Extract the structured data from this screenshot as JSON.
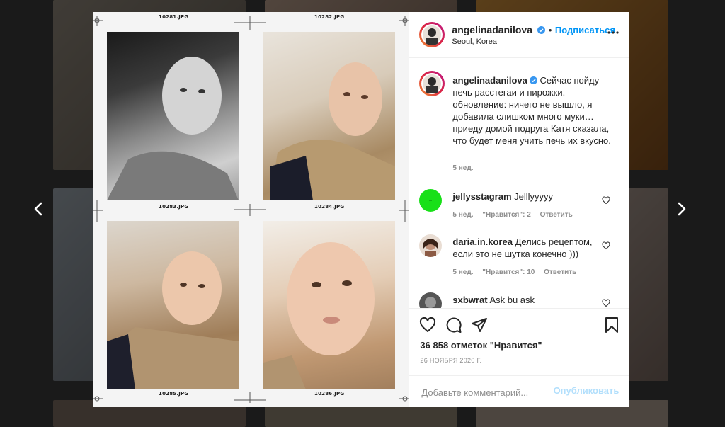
{
  "colors": {
    "accent": "#0095f6",
    "publish_disabled": "#b2dffc",
    "text": "#262626",
    "muted": "#8e8e8e"
  },
  "nav": {
    "prev_icon": "chevron-left-icon",
    "next_icon": "chevron-right-icon"
  },
  "media": {
    "frames": [
      {
        "label": "10281.JPG"
      },
      {
        "label": "10282.JPG"
      },
      {
        "label": "10283.JPG"
      },
      {
        "label": "10284.JPG"
      },
      {
        "label": "10285.JPG"
      },
      {
        "label": "10286.JPG"
      }
    ]
  },
  "header": {
    "username": "angelinadanilova",
    "dot": "•",
    "follow_label": "Подписаться",
    "location": "Seoul, Korea"
  },
  "caption": {
    "username": "angelinadanilova",
    "text": "Сейчас пойду печь расстегаи и пирожки. обновление: ничего не вышло, я добавила слишком много муки…приеду домой подруга Катя сказала, что будет меня учить печь их вкусно.",
    "time": "5 нед."
  },
  "comments": [
    {
      "username": "jellysstagram",
      "text": "Jelllyyyyy",
      "time": "5 нед.",
      "likes": "\"Нравится\": 2",
      "reply": "Ответить"
    },
    {
      "username": "daria.in.korea",
      "text": "Делись рецептом, если это не шутка конечно )))",
      "time": "5 нед.",
      "likes": "\"Нравится\": 10",
      "reply": "Ответить"
    },
    {
      "username": "sxbwrat",
      "text": "Ask bu ask"
    }
  ],
  "actions": {
    "likes": "36 858 отметок \"Нравится\"",
    "date": "26 НОЯБРЯ 2020 Г."
  },
  "comment_box": {
    "placeholder": "Добавьте комментарий...",
    "publish_label": "Опубликовать"
  }
}
